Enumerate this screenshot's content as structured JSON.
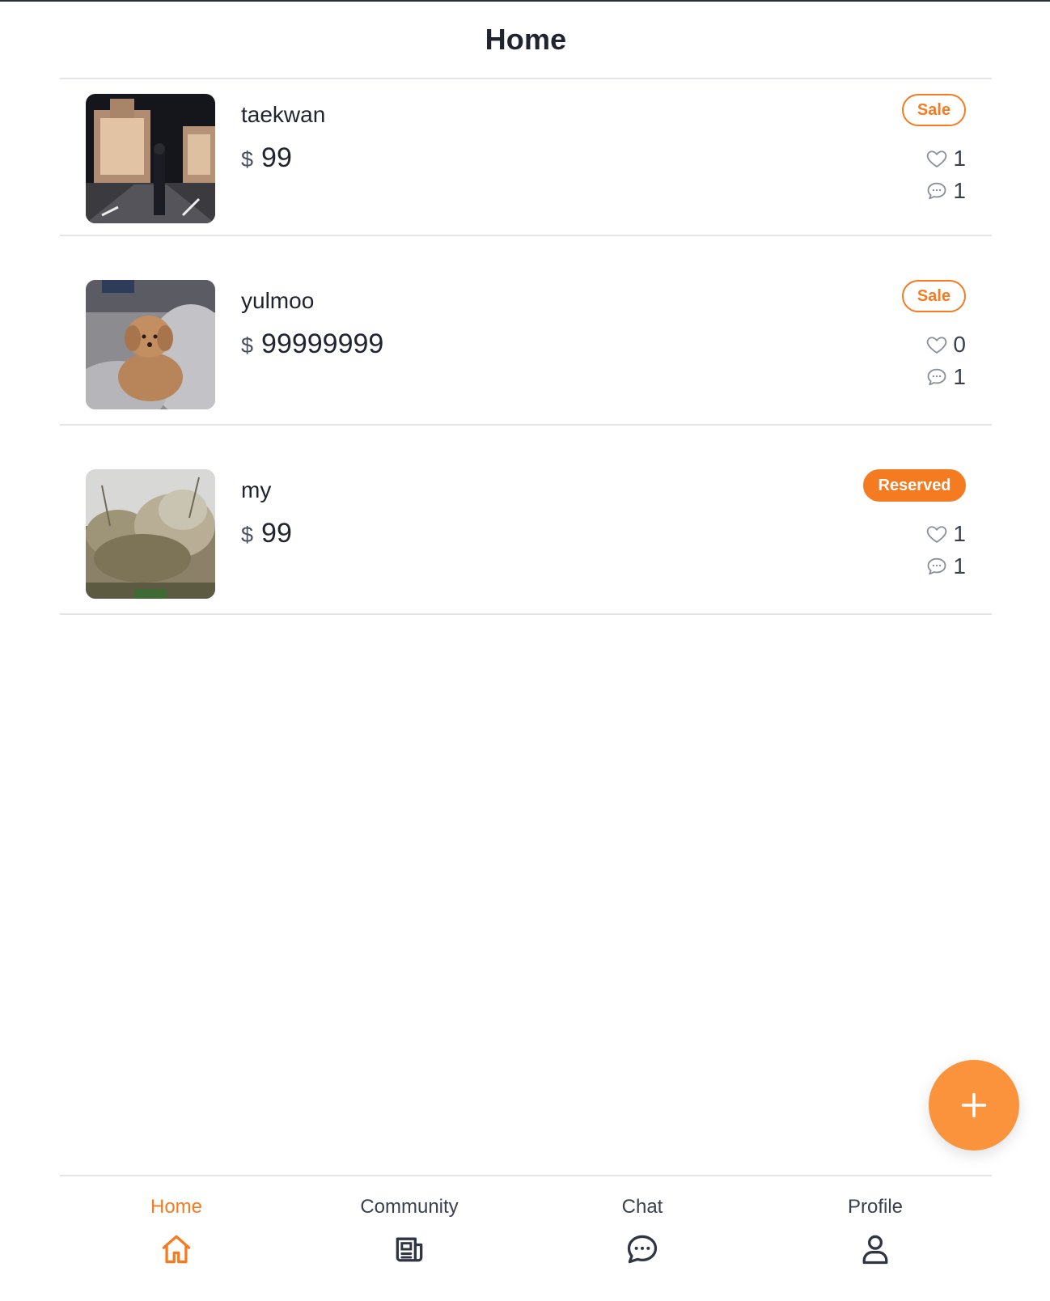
{
  "header": {
    "title": "Home"
  },
  "colors": {
    "accent": "#f47b20",
    "fab": "#fb923c",
    "text": "#1f2430"
  },
  "items": [
    {
      "title": "taekwan",
      "currency": "$",
      "price": "99",
      "status": "Sale",
      "status_style": "outline",
      "likes": "1",
      "comments": "1",
      "image_icon": "street-night-photo"
    },
    {
      "title": "yulmoo",
      "currency": "$",
      "price": "99999999",
      "status": "Sale",
      "status_style": "outline",
      "likes": "0",
      "comments": "1",
      "image_icon": "dog-photo"
    },
    {
      "title": "my",
      "currency": "$",
      "price": "99",
      "status": "Reserved",
      "status_style": "filled",
      "likes": "1",
      "comments": "1",
      "image_icon": "trees-photo"
    }
  ],
  "fab": {
    "icon": "plus-icon"
  },
  "tabs": [
    {
      "label": "Home",
      "icon": "home-icon",
      "active": true
    },
    {
      "label": "Community",
      "icon": "newspaper-icon",
      "active": false
    },
    {
      "label": "Chat",
      "icon": "chat-bubble-icon",
      "active": false
    },
    {
      "label": "Profile",
      "icon": "user-icon",
      "active": false
    }
  ]
}
